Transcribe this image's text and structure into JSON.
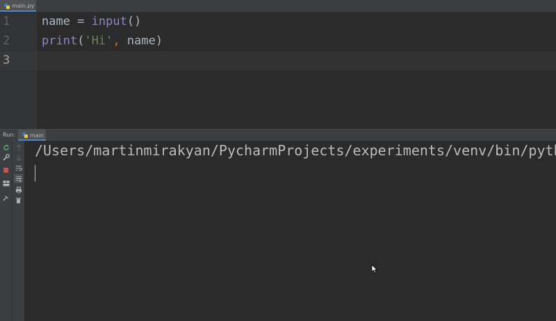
{
  "editor": {
    "tab": {
      "label": "main.py",
      "icon": "python-file-icon"
    },
    "lines": [
      {
        "number": "1",
        "code": "name = input()"
      },
      {
        "number": "2",
        "code": "print('Hi', name)"
      },
      {
        "number": "3",
        "code": ""
      }
    ]
  },
  "run_panel": {
    "label": "Run:",
    "tab_label": "main",
    "output_line": "/Users/martinmirakyan/PycharmProjects/experiments/venv/bin/pyth"
  },
  "colors": {
    "background": "#2b2b2b",
    "keyword": "#8888c6",
    "string": "#6a8759",
    "comma": "#cc7832",
    "rerun_icon": "#59a869",
    "stop_icon": "#c75450"
  },
  "icons": {
    "run_toolbar": [
      "rerun-icon",
      "wrench-icon",
      "stop-icon",
      "layout-icon",
      "pin-icon"
    ],
    "console_toolbar": [
      "up-arrow-icon",
      "down-arrow-icon",
      "soft-wrap-icon",
      "scroll-to-end-icon",
      "print-icon",
      "trash-icon"
    ]
  }
}
